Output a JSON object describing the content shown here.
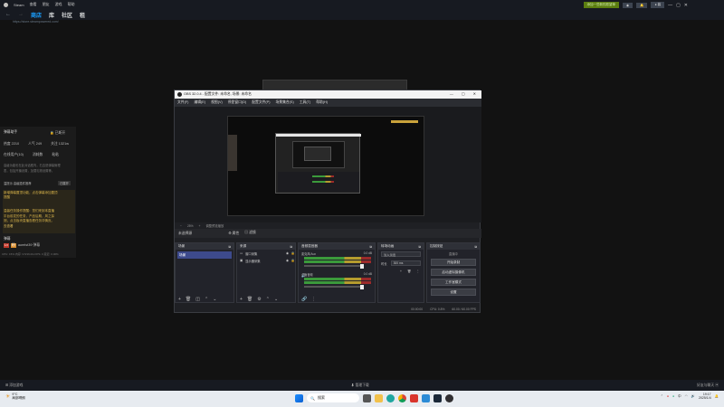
{
  "steam": {
    "app_name": "Steam",
    "menu": [
      "查看",
      "朋友",
      "游戏",
      "帮助"
    ],
    "nav": [
      "商店",
      "库",
      "社区",
      "租"
    ],
    "url": "https://store.steampowered.com/",
    "top_right": {
      "wishlist_btn": "添加一些新的愿望单",
      "notif": "",
      "user": "暮"
    },
    "bottom_left": "添加游戏",
    "bottom_center": "管理下载",
    "bottom_right": "好友与聊天"
  },
  "left_panel": {
    "title": "弹幕助手",
    "status": "已断开",
    "stats": [
      "热度 2210",
      "人气 249",
      "关注 1321w"
    ],
    "tabs": [
      "在线用户(10)",
      "消耗数",
      "粘粘"
    ],
    "hint1": "高级功能也在此对话框内，右边是弹幕管理",
    "hint2": "表，包括开播设置，加载礼物设置等。",
    "tip_label": "温提示",
    "tip_label2": "高级插件推荐",
    "tip_btn": "已展开",
    "notice1": "新增弹幕置顶功能，点击弹幕添加置顶",
    "notice1b": "提醒",
    "notice2": "温馨任务操作提醒：您们来到本直播",
    "notice2b": "平台前发的任务，产品后期，风之探",
    "notice2c": "测，点击板块直播查看任务详情页。",
    "notice_link": "去查看",
    "section": "弹幕",
    "user_line": "aurelst39 弹幕",
    "footer": "CPU: 15%  内存: 3.5/16.0G  FPS: 0  延迟: 0.00%"
  },
  "obs": {
    "title": "OBS 32.0.4 - 配置文件: 未命名, 场景: 未命名",
    "menu": [
      "文件(F)",
      "编辑(E)",
      "视图(V)",
      "停靠窗口(D)",
      "配置文件(P)",
      "场景集合(S)",
      "工具(T)",
      "帮助(H)"
    ],
    "preview_zoom": "25%",
    "preview_label": "调整预览缩放",
    "scene_bar": {
      "current": "未选择源",
      "props": "属性",
      "filters": "滤镜"
    },
    "docks": {
      "scenes": {
        "title": "场景",
        "items": [
          "场景"
        ]
      },
      "sources": {
        "title": "来源",
        "items": [
          "窗口采集",
          "显示器采集"
        ]
      },
      "mixer": {
        "title": "音频混音器",
        "channels": [
          {
            "name": "麦克风/Aux",
            "db": "0.0 dB"
          },
          {
            "name": "桌面音频",
            "db": "0.0 dB"
          }
        ]
      },
      "transitions": {
        "title": "转场动画",
        "type": "淡入淡出",
        "duration_label": "时长",
        "duration": "300 ms"
      },
      "controls": {
        "title": "控制按钮",
        "status": "直播中",
        "buttons": [
          "开始录制",
          "启动虚拟摄像机",
          "工作室模式",
          "设置"
        ]
      }
    },
    "status_bar": {
      "rec": "00:00:00",
      "cpu": "CPU: 0.8%",
      "fps": "60.00 / 60.00 FPS"
    }
  },
  "taskbar": {
    "weather_temp": "9°C",
    "weather_desc": "局部晴朗",
    "search_placeholder": "搜索",
    "time": "19:17",
    "date": "2025/1/4",
    "tray_lang": "中"
  },
  "colors": {
    "obs_bg": "#1f2024",
    "scene_select": "#3d4a8c",
    "steam_blue": "#1a9fff",
    "steam_bg": "#171a21"
  }
}
